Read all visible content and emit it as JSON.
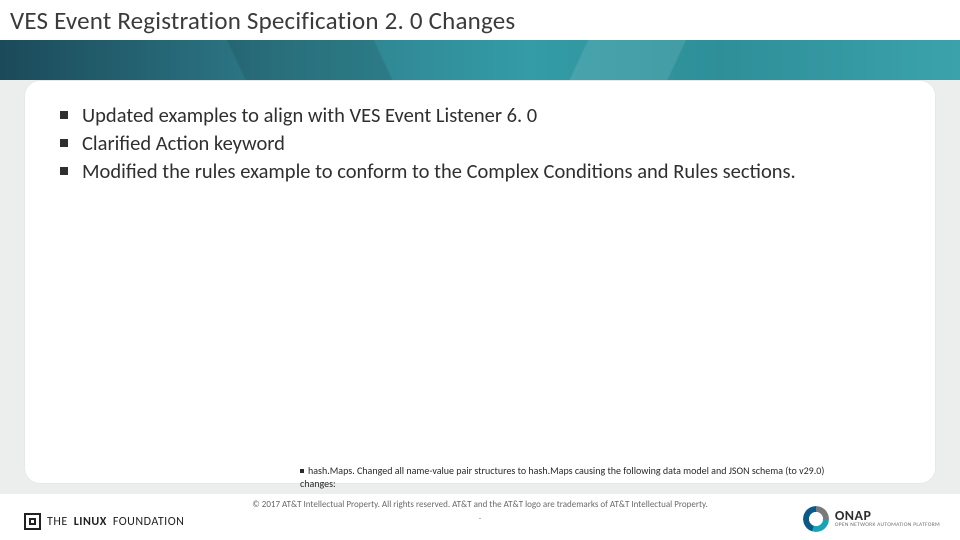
{
  "title": "VES Event Registration Specification 2. 0 Changes",
  "bullets": [
    "Updated examples to align with VES Event Listener 6. 0",
    "Clarified Action keyword",
    "Modified the rules example to conform to the Complex Conditions and Rules sections."
  ],
  "small_note": "hash.Maps. Changed all name-value pair structures to hash.Maps causing the following data model and JSON schema (to v29.0) changes:",
  "copyright_line": "© 2017 AT&T Intellectual Property. All rights reserved. AT&T and the AT&T logo are trademarks of AT&T Intellectual Property.",
  "copyright_sub": ".",
  "logo_left": {
    "part1": "THE",
    "part2": "LINUX",
    "part3": "FOUNDATION"
  },
  "logo_right": {
    "name": "ONAP",
    "tag": "OPEN NETWORK AUTOMATION PLATFORM"
  }
}
